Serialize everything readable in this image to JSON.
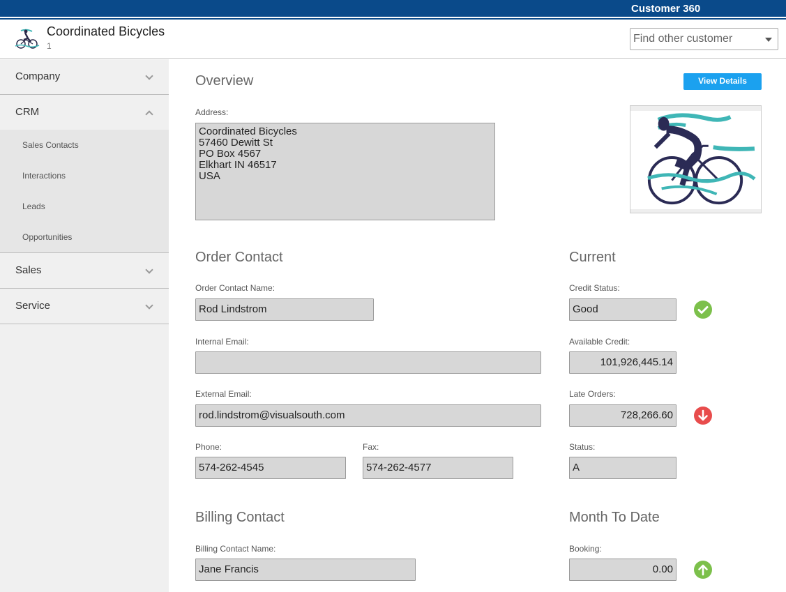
{
  "app": {
    "title": "Customer 360"
  },
  "customer": {
    "name": "Coordinated Bicycles",
    "id": "1",
    "logo_icon": "cyclist-logo"
  },
  "search": {
    "placeholder": "Find other customer"
  },
  "sidebar": {
    "groups": [
      {
        "label": "Company",
        "expanded": false
      },
      {
        "label": "CRM",
        "expanded": true,
        "items": [
          "Sales Contacts",
          "Interactions",
          "Leads",
          "Opportunities"
        ]
      },
      {
        "label": "Sales",
        "expanded": false
      },
      {
        "label": "Service",
        "expanded": false
      }
    ]
  },
  "overview": {
    "title": "Overview",
    "view_details_label": "View Details",
    "address_label": "Address:",
    "address": "Coordinated Bicycles\n57460 Dewitt St\nPO Box 4567\nElkhart IN 46517\nUSA"
  },
  "order_contact": {
    "title": "Order Contact",
    "name_label": "Order Contact Name:",
    "name": "Rod Lindstrom",
    "internal_email_label": "Internal Email:",
    "internal_email": "",
    "external_email_label": "External Email:",
    "external_email": "rod.lindstrom@visualsouth.com",
    "phone_label": "Phone:",
    "phone": "574-262-4545",
    "fax_label": "Fax:",
    "fax": "574-262-4577"
  },
  "current": {
    "title": "Current",
    "credit_status_label": "Credit Status:",
    "credit_status": "Good",
    "credit_status_icon": "check-circle-icon",
    "available_credit_label": "Available Credit:",
    "available_credit": "101,926,445.14",
    "late_orders_label": "Late Orders:",
    "late_orders": "728,266.60",
    "late_orders_icon": "arrow-down-circle-icon",
    "status_label": "Status:",
    "status": "A"
  },
  "billing_contact": {
    "title": "Billing Contact",
    "name_label": "Billing Contact Name:",
    "name": "Jane Francis"
  },
  "month_to_date": {
    "title": "Month To Date",
    "booking_label": "Booking:",
    "booking": "0.00",
    "booking_icon": "arrow-up-circle-icon"
  },
  "colors": {
    "topbar": "#0a4a8a",
    "button": "#1ba1ef",
    "good": "#7cc04b",
    "bad": "#e84c4c"
  }
}
